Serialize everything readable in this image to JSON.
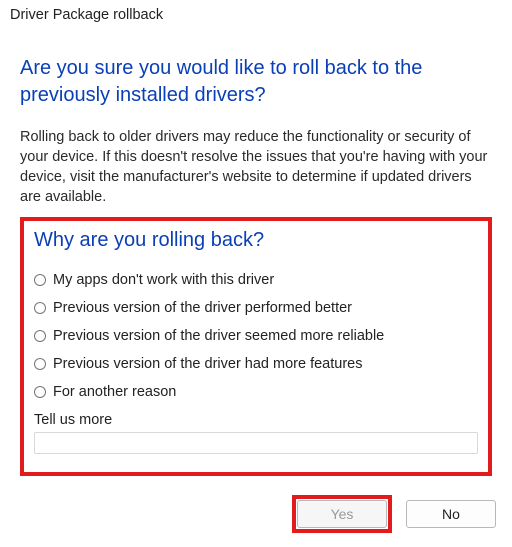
{
  "window": {
    "title": "Driver Package rollback"
  },
  "heading": "Are you sure you would like to roll back to the previously installed drivers?",
  "description": "Rolling back to older drivers may reduce the functionality or security of your device. If this doesn't resolve the issues that you're having with your device, visit the manufacturer's website to determine if updated drivers are available.",
  "reason": {
    "title": "Why are you rolling back?",
    "options": [
      "My apps don't work with this driver",
      "Previous version of the driver performed better",
      "Previous version of the driver seemed more reliable",
      "Previous version of the driver had more features",
      "For another reason"
    ],
    "tell_us_label": "Tell us more",
    "tell_us_value": ""
  },
  "buttons": {
    "yes": "Yes",
    "no": "No"
  },
  "highlight": {
    "reason_box": true,
    "yes_button": true
  }
}
